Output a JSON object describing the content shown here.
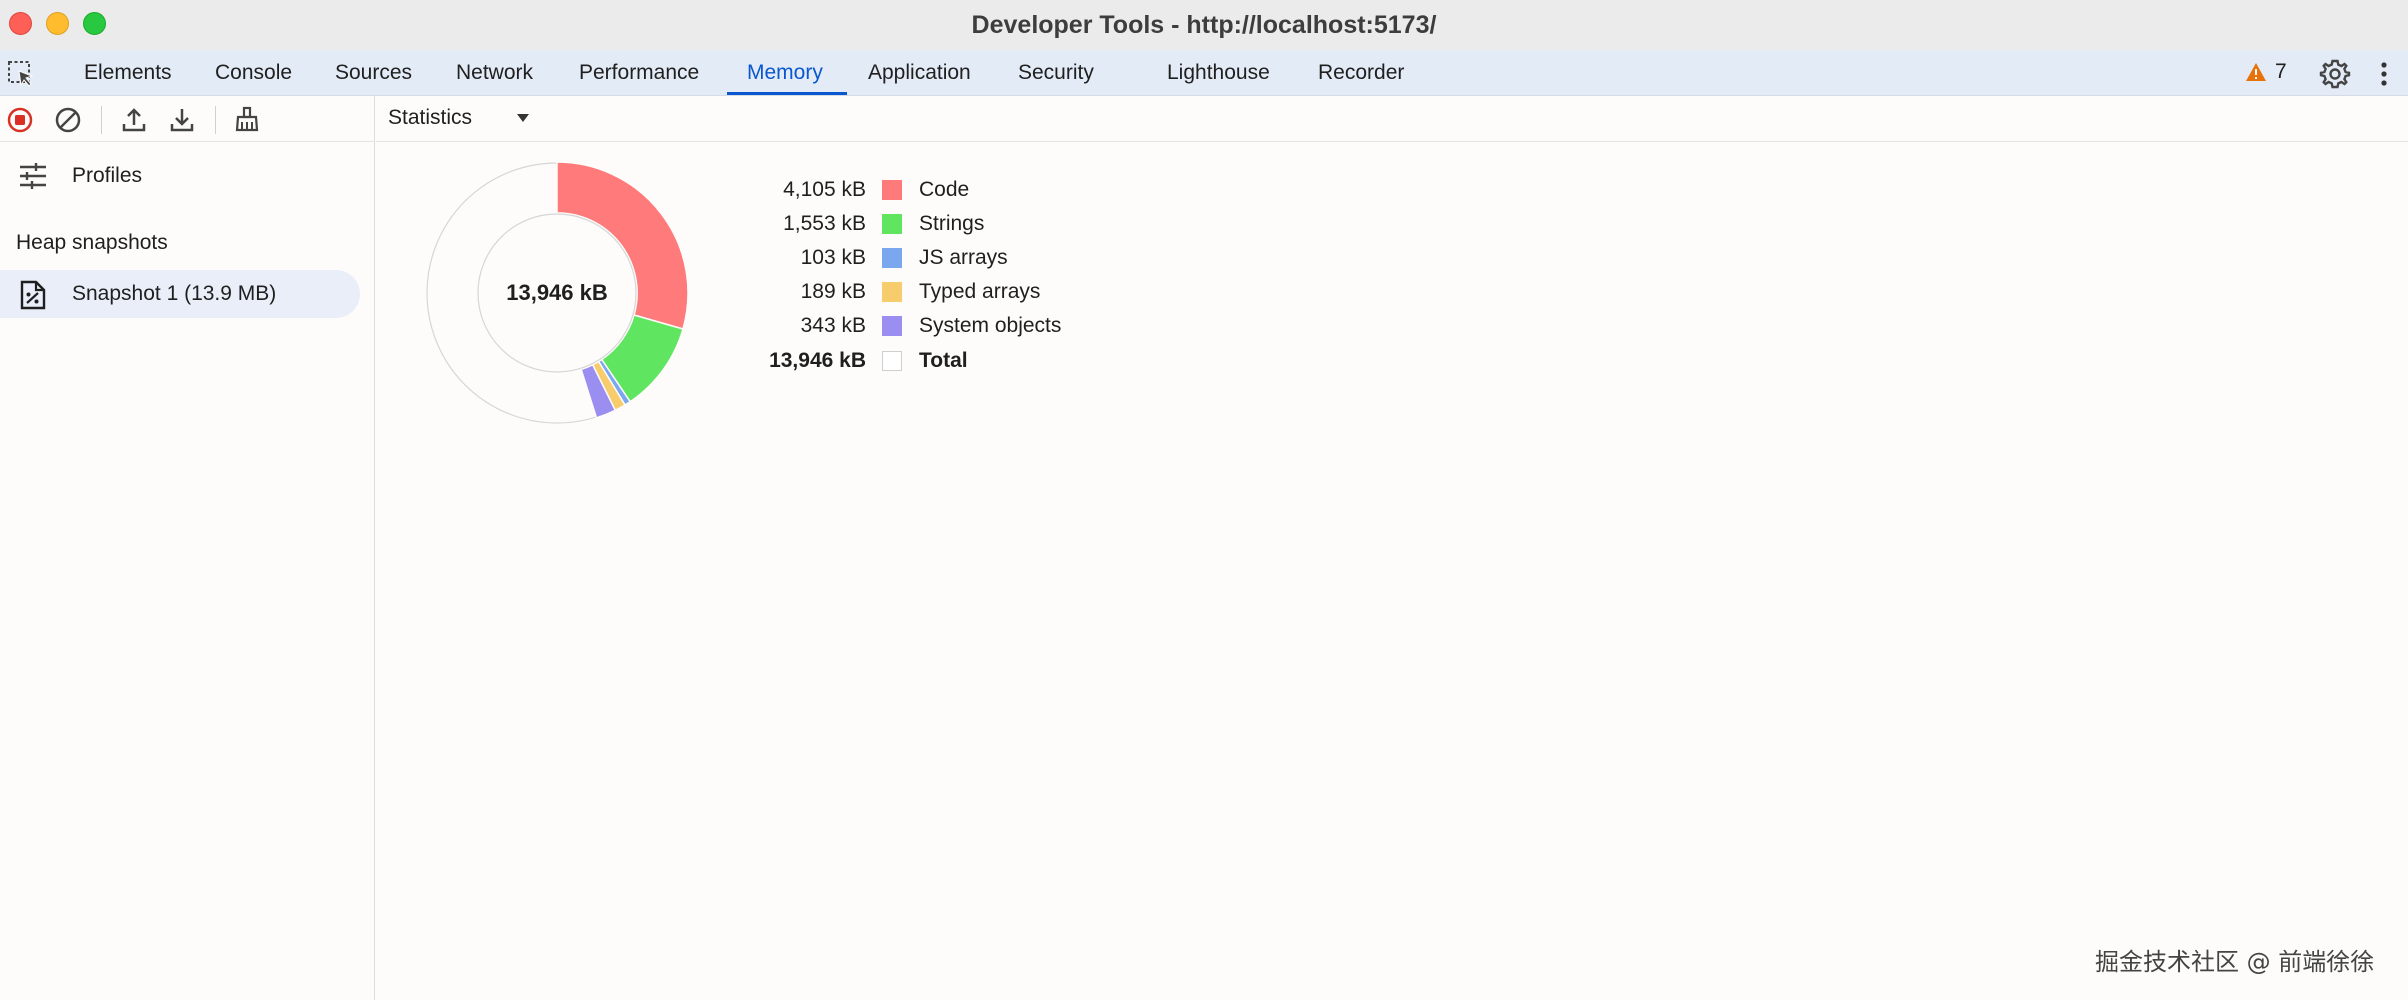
{
  "window": {
    "title": "Developer Tools - http://localhost:5173/"
  },
  "tabs": [
    {
      "label": "Elements"
    },
    {
      "label": "Console"
    },
    {
      "label": "Sources"
    },
    {
      "label": "Network"
    },
    {
      "label": "Performance"
    },
    {
      "label": "Memory"
    },
    {
      "label": "Application"
    },
    {
      "label": "Security"
    },
    {
      "label": "Lighthouse"
    },
    {
      "label": "Recorder"
    }
  ],
  "active_tab": "Memory",
  "issues": {
    "count": "7",
    "color": "#e8710a"
  },
  "accent_color": "#0b57d0",
  "sidebar": {
    "profiles_label": "Profiles",
    "section_title": "Heap snapshots",
    "snapshot_label": "Snapshot 1 (13.9 MB)"
  },
  "view_select": {
    "value": "Statistics"
  },
  "statistics": {
    "total_display": "13,946 kB",
    "total_kb": 13946,
    "items": [
      {
        "label": "Code",
        "value": "4,105 kB",
        "kb": 4105,
        "color": "#ff7b7b"
      },
      {
        "label": "Strings",
        "value": "1,553 kB",
        "kb": 1553,
        "color": "#5fe55f"
      },
      {
        "label": "JS arrays",
        "value": "103 kB",
        "kb": 103,
        "color": "#7aa7ee"
      },
      {
        "label": "Typed arrays",
        "value": "189 kB",
        "kb": 189,
        "color": "#f7cc6c"
      },
      {
        "label": "System objects",
        "value": "343 kB",
        "kb": 343,
        "color": "#9a8ef0"
      }
    ],
    "total_row": {
      "label": "Total",
      "value": "13,946 kB"
    }
  },
  "watermark": "掘金技术社区 @ 前端徐徐"
}
